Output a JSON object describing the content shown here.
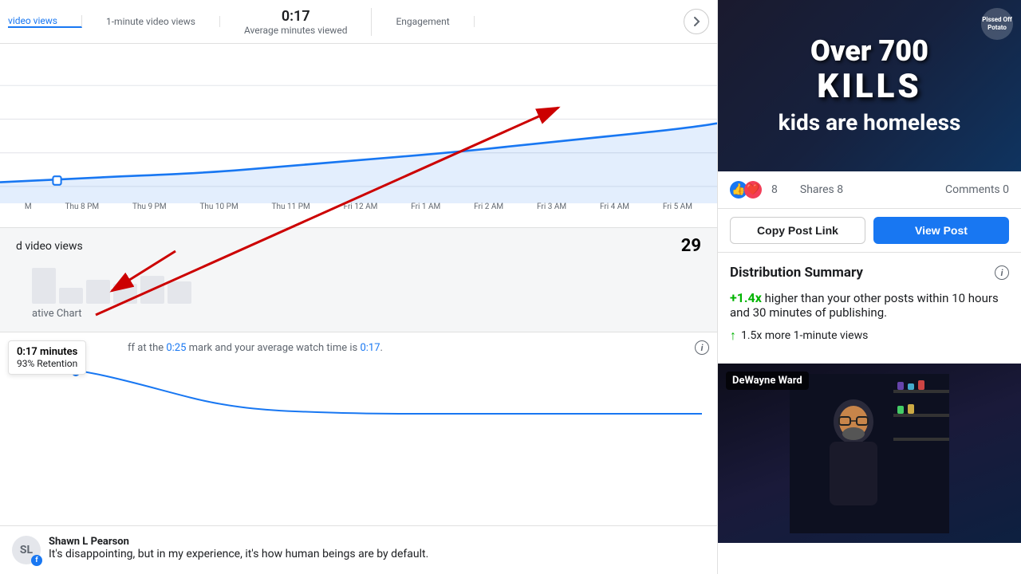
{
  "metrics": [
    {
      "label": "video views",
      "value": "",
      "active": true
    },
    {
      "label": "1-minute video views",
      "value": ""
    },
    {
      "label": "Average minutes viewed",
      "value": "0:17"
    },
    {
      "label": "Engagement",
      "value": ""
    }
  ],
  "chart": {
    "timeLabels": [
      "Thu 8 PM",
      "Thu 9 PM",
      "Thu 10 PM",
      "Thu 11 PM",
      "Fri 12 AM",
      "Fri 1 AM",
      "Fri 2 AM",
      "Fri 3 AM",
      "Fri 4 AM",
      "Fri 5 AM"
    ]
  },
  "views_section": {
    "label": "d video views",
    "count": "29"
  },
  "chart_label": "ative Chart",
  "retention": {
    "tooltip_time": "0:17 minutes",
    "tooltip_pct": "93% Retention",
    "text_prefix": "ff at the ",
    "mark": "0:25",
    "text_mid": " mark and your average watch time is ",
    "avg_time": "0:17",
    "text_suffix": "."
  },
  "comment": {
    "commenter": "Shawn L Pearson",
    "text": "It's disappointing, but in my experience, it's how human beings are by default.",
    "avatar_initials": "SL"
  },
  "right_panel": {
    "video": {
      "over_text": "Over 700",
      "main_text": "KILLS",
      "tagline": "kids are homeless",
      "brand": "Pissed Off Potato"
    },
    "reactions": {
      "count": "8",
      "shares": "Shares 8",
      "comments": "Comments 0"
    },
    "buttons": {
      "copy": "Copy Post Link",
      "view": "View Post"
    },
    "distribution": {
      "title": "Distribution Summary",
      "stat1_highlight": "+1.4x",
      "stat1_text": " higher than your other posts within 10 hours and 30 minutes of publishing.",
      "stat2_text": "1.5x more 1-minute views"
    },
    "streamer": {
      "name": "DeWayne Ward"
    }
  }
}
